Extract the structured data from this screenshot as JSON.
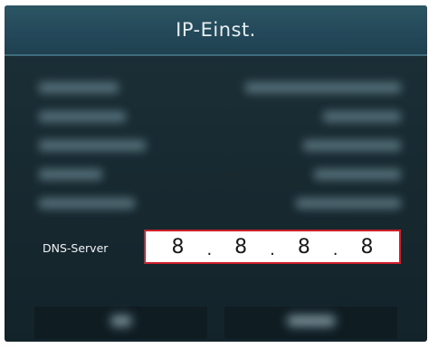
{
  "dialog": {
    "title": "IP-Einst."
  },
  "dns": {
    "label": "DNS-Server",
    "octets": [
      "8",
      "8",
      "8",
      "8"
    ],
    "separator": "."
  }
}
